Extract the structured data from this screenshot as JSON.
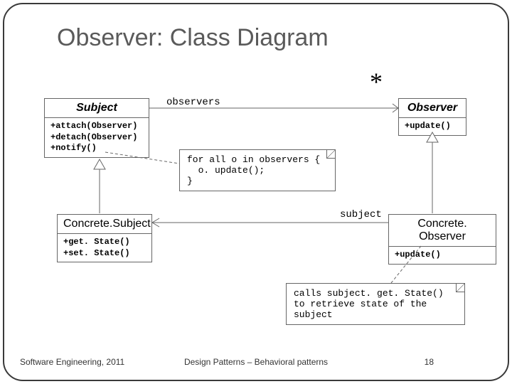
{
  "title": "Observer: Class Diagram",
  "star": "*",
  "assoc": {
    "observers": "observers",
    "subject": "subject"
  },
  "classes": {
    "subject": {
      "name": "Subject",
      "ops": [
        "+attach(Observer)",
        "+detach(Observer)",
        "+notify()"
      ]
    },
    "observer": {
      "name": "Observer",
      "ops": [
        "+update()"
      ]
    },
    "concrete_subject": {
      "name": "Concrete.Subject",
      "ops": [
        "+get. State()",
        "+set. State()"
      ]
    },
    "concrete_observer": {
      "name": "Concrete. Observer",
      "ops": [
        "+update()"
      ]
    }
  },
  "notes": {
    "notify": [
      "for all o in observers {",
      "  o. update();",
      "}"
    ],
    "update": "calls subject. get. State() to retrieve state of the subject"
  },
  "footer": {
    "left": "Software Engineering, 2011",
    "center": "Design Patterns – Behavioral patterns",
    "page": "18"
  }
}
